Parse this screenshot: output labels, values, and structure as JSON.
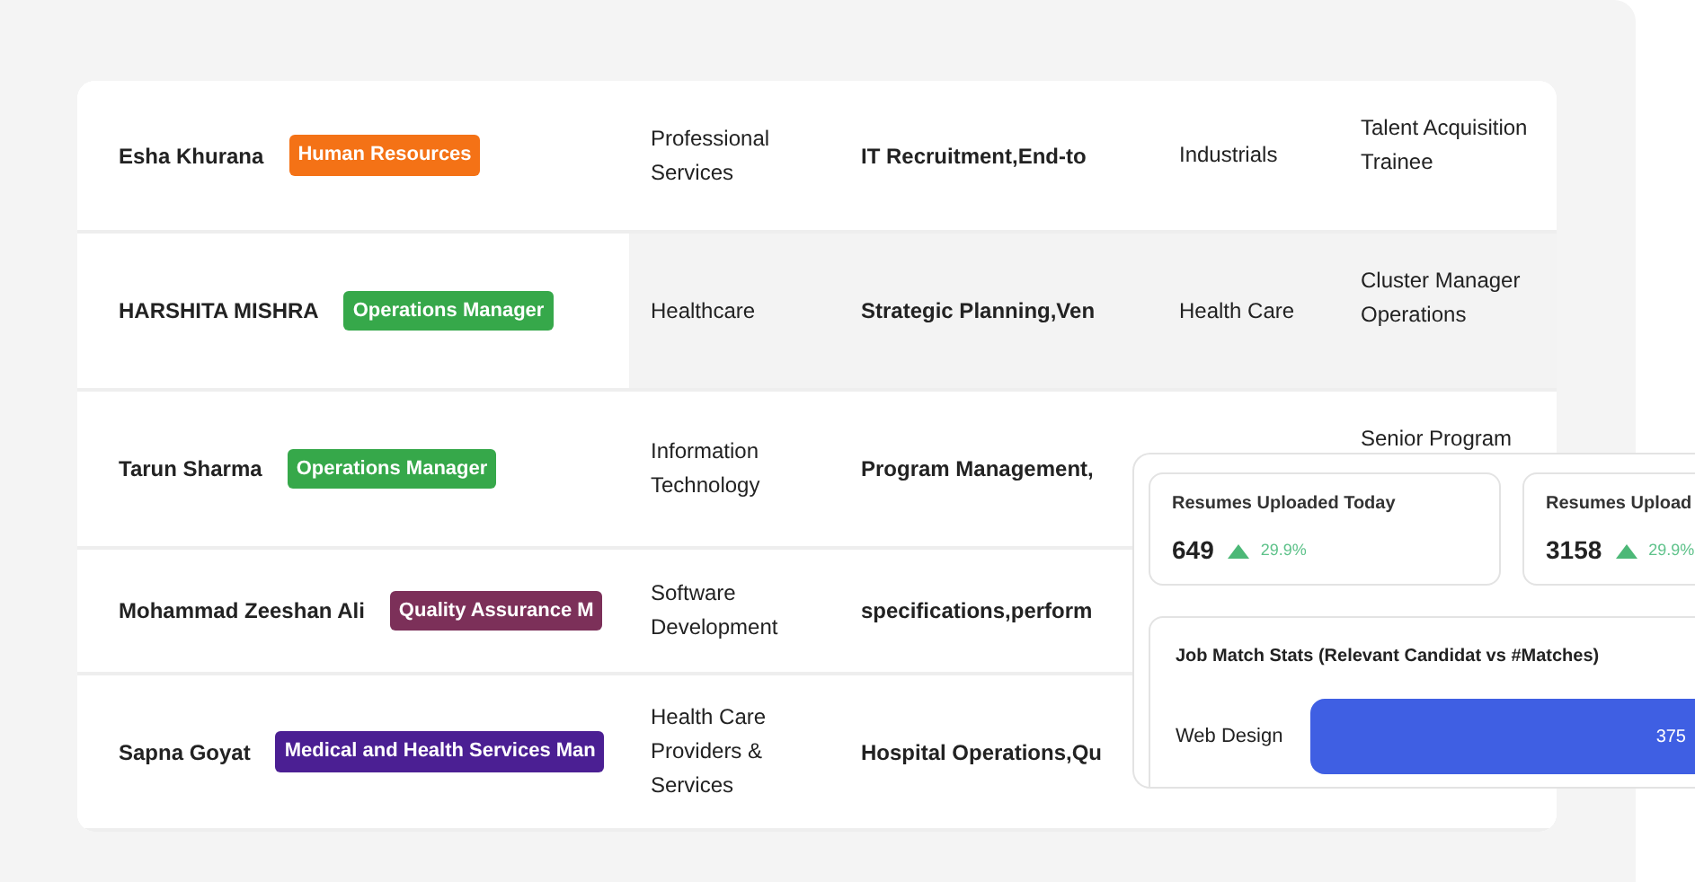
{
  "table": {
    "rows": [
      {
        "name": "Esha Khurana",
        "tag": {
          "label": "Human Resources",
          "color": "#f47216"
        },
        "industry": "Professional Services",
        "skills": "IT Recruitment,End-to",
        "sector": "Industrials",
        "role": "Talent Acquisition Trainee",
        "hovered": false
      },
      {
        "name": "HARSHITA MISHRA",
        "tag": {
          "label": "Operations Manager",
          "color": "#36a84a"
        },
        "industry": "Healthcare",
        "skills": "Strategic Planning,Ven",
        "sector": "Health Care",
        "role": "Cluster Manager Operations",
        "hovered": true
      },
      {
        "name": "Tarun Sharma",
        "tag": {
          "label": "Operations Manager",
          "color": "#36a84a"
        },
        "industry": "Information Technology",
        "skills": "Program Management,",
        "role": "Senior Program",
        "hovered": false
      },
      {
        "name": "Mohammad Zeeshan Ali",
        "tag": {
          "label": "Quality Assurance M",
          "color": "#7c3059"
        },
        "industry": "Software Development",
        "skills": "specifications,perform",
        "hovered": false
      },
      {
        "name": "Sapna Goyat",
        "tag": {
          "label": "Medical and Health Services Man",
          "color": "#4b1f93"
        },
        "industry": "Health Care Providers & Services",
        "skills": "Hospital Operations,Qu",
        "hovered": false
      }
    ]
  },
  "stats": [
    {
      "title": "Resumes Uploaded Today",
      "value": "649",
      "change": "29.9%"
    },
    {
      "title": "Resumes Upload",
      "value": "3158",
      "change": "29.9%"
    }
  ],
  "job_match": {
    "title": "Job Match Stats (Relevant Candidat vs #Matches)",
    "bars": [
      {
        "label": "Web Design",
        "value": "375"
      }
    ]
  }
}
